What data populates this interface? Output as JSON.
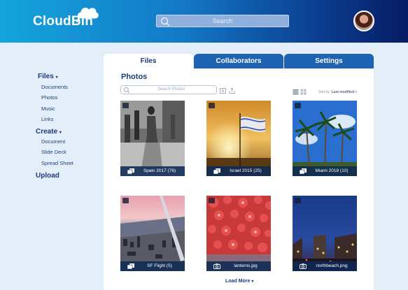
{
  "app": {
    "logo": "CloudBin"
  },
  "header": {
    "search_placeholder": "Search"
  },
  "sidebar": {
    "files_label": "Files",
    "files_items": [
      "Documents",
      "Photos",
      "Music",
      "Links"
    ],
    "create_label": "Create",
    "create_items": [
      "Document",
      "Slide Deck",
      "Spread Sheet"
    ],
    "upload_label": "Upload"
  },
  "tabs": [
    {
      "label": "Files",
      "active": true
    },
    {
      "label": "Collaborators",
      "active": false
    },
    {
      "label": "Settings",
      "active": false
    }
  ],
  "content": {
    "title": "Photos",
    "search_placeholder": "Search Photos",
    "sort_label": "Sort by:",
    "sort_value": "Last modified",
    "load_more": "Load More"
  },
  "photos": [
    {
      "label": "Spain 2017 (76)",
      "kind": "album",
      "icon": "album-icon"
    },
    {
      "label": "Israel 2015 (25)",
      "kind": "album",
      "icon": "album-icon"
    },
    {
      "label": "Miami 2018 (10)",
      "kind": "album",
      "icon": "album-icon"
    },
    {
      "label": "SF Flight (5)",
      "kind": "album",
      "icon": "album-icon"
    },
    {
      "label": "lanterns.jpg",
      "kind": "photo",
      "icon": "camera-icon"
    },
    {
      "label": "northbeach.png",
      "kind": "photo",
      "icon": "camera-icon"
    }
  ],
  "colors": {
    "header_start": "#14a5dc",
    "header_end": "#071d63",
    "tab_inactive": "#1d63b1",
    "page_bg": "#e4eef8"
  }
}
